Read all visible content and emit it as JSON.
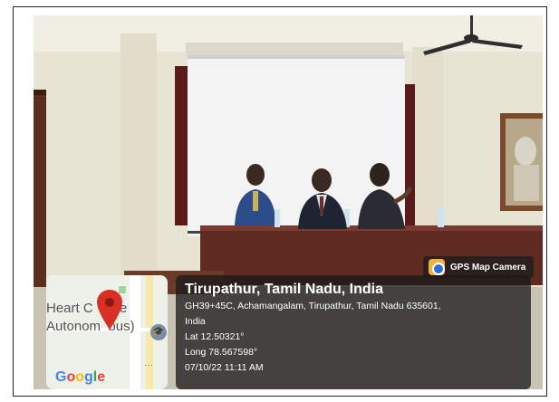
{
  "overlay": {
    "app_badge": "GPS Map Camera",
    "map": {
      "label_line1": "Heart C",
      "label_line1b": "ege",
      "label_line2": "Autonom",
      "label_line2b": "bus)",
      "brand": "Google"
    },
    "location": {
      "title": "Tirupathur, Tamil Nadu, India",
      "address": "GH39+45C, Achamangalam, Tirupathur, Tamil Nadu 635601,",
      "country": "India",
      "lat": "Lat 12.50321°",
      "long": "Long 78.567598°",
      "datetime": "07/10/22 11:11 AM"
    }
  },
  "colors": {
    "pin": "#d93025",
    "google_blue": "#4285f4",
    "google_red": "#ea4335",
    "google_yellow": "#fbbc05",
    "google_green": "#34a853"
  }
}
